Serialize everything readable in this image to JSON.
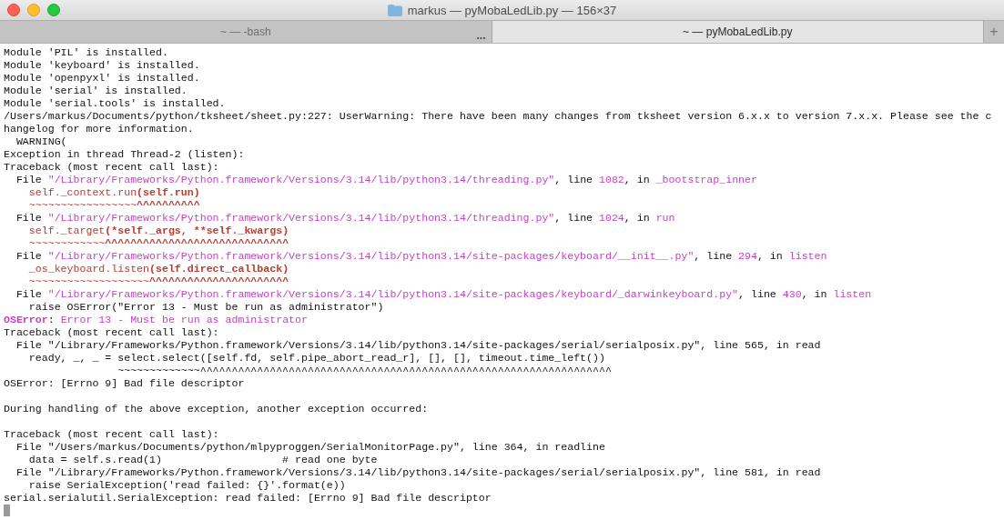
{
  "window": {
    "title": "markus — pyMobaLedLib.py — 156×37"
  },
  "tabs": [
    {
      "label": "~ — -bash",
      "selected": false,
      "more": "..."
    },
    {
      "label": "~ — pyMobaLedLib.py",
      "selected": true
    }
  ],
  "new_tab": "+",
  "terminal": {
    "cursor": true,
    "lines": [
      {
        "segs": [
          {
            "t": "Module 'PIL' is installed.",
            "kind": "plain"
          }
        ]
      },
      {
        "segs": [
          {
            "t": "Module 'keyboard' is installed.",
            "kind": "plain"
          }
        ]
      },
      {
        "segs": [
          {
            "t": "Module 'openpyxl' is installed.",
            "kind": "plain"
          }
        ]
      },
      {
        "segs": [
          {
            "t": "Module 'serial' is installed.",
            "kind": "plain"
          }
        ]
      },
      {
        "segs": [
          {
            "t": "Module 'serial.tools' is installed.",
            "kind": "plain"
          }
        ]
      },
      {
        "segs": [
          {
            "t": "/Users/markus/Documents/python/tksheet/sheet.py:227: UserWarning: There have been many changes from tksheet version 6.x.x to version 7.x.x. Please see the c",
            "kind": "plain"
          }
        ]
      },
      {
        "segs": [
          {
            "t": "hangelog for more information.",
            "kind": "plain"
          }
        ]
      },
      {
        "segs": [
          {
            "t": "  WARNING(",
            "kind": "plain"
          }
        ]
      },
      {
        "segs": [
          {
            "t": "Exception in thread Thread-2 (listen):",
            "kind": "plain"
          }
        ]
      },
      {
        "segs": [
          {
            "t": "Traceback (most recent call last):",
            "kind": "plain"
          }
        ]
      },
      {
        "segs": [
          {
            "t": "  File ",
            "kind": "plain"
          },
          {
            "t": "\"/Library/Frameworks/Python.framework/Versions/3.14/lib/python3.14/threading.py\"",
            "kind": "accent"
          },
          {
            "t": ", line ",
            "kind": "plain"
          },
          {
            "t": "1082",
            "kind": "accent"
          },
          {
            "t": ", in ",
            "kind": "plain"
          },
          {
            "t": "_bootstrap_inner",
            "kind": "accent"
          }
        ]
      },
      {
        "segs": [
          {
            "t": "    self._context.run",
            "kind": "code"
          },
          {
            "t": "(self.run)",
            "kind": "code_bold"
          }
        ]
      },
      {
        "segs": [
          {
            "t": "    ~~~~~~~~~~~~~~~~~",
            "kind": "code"
          },
          {
            "t": "^^^^^^^^^^",
            "kind": "code_bold"
          }
        ]
      },
      {
        "segs": [
          {
            "t": "  File ",
            "kind": "plain"
          },
          {
            "t": "\"/Library/Frameworks/Python.framework/Versions/3.14/lib/python3.14/threading.py\"",
            "kind": "accent"
          },
          {
            "t": ", line ",
            "kind": "plain"
          },
          {
            "t": "1024",
            "kind": "accent"
          },
          {
            "t": ", in ",
            "kind": "plain"
          },
          {
            "t": "run",
            "kind": "accent"
          }
        ]
      },
      {
        "segs": [
          {
            "t": "    self._target",
            "kind": "code"
          },
          {
            "t": "(*self._args, **self._kwargs)",
            "kind": "code_bold"
          }
        ]
      },
      {
        "segs": [
          {
            "t": "    ~~~~~~~~~~~~",
            "kind": "code"
          },
          {
            "t": "^^^^^^^^^^^^^^^^^^^^^^^^^^^^^",
            "kind": "code_bold"
          }
        ]
      },
      {
        "segs": [
          {
            "t": "  File ",
            "kind": "plain"
          },
          {
            "t": "\"/Library/Frameworks/Python.framework/Versions/3.14/lib/python3.14/site-packages/keyboard/__init__.py\"",
            "kind": "accent"
          },
          {
            "t": ", line ",
            "kind": "plain"
          },
          {
            "t": "294",
            "kind": "accent"
          },
          {
            "t": ", in ",
            "kind": "plain"
          },
          {
            "t": "listen",
            "kind": "accent"
          }
        ]
      },
      {
        "segs": [
          {
            "t": "    _os_keyboard.listen",
            "kind": "code"
          },
          {
            "t": "(self.direct_callback)",
            "kind": "code_bold"
          }
        ]
      },
      {
        "segs": [
          {
            "t": "    ~~~~~~~~~~~~~~~~~~~",
            "kind": "code"
          },
          {
            "t": "^^^^^^^^^^^^^^^^^^^^^^",
            "kind": "code_bold"
          }
        ]
      },
      {
        "segs": [
          {
            "t": "  File ",
            "kind": "plain"
          },
          {
            "t": "\"/Library/Frameworks/Python.framework/Versions/3.14/lib/python3.14/site-packages/keyboard/_darwinkeyboard.py\"",
            "kind": "accent"
          },
          {
            "t": ", line ",
            "kind": "plain"
          },
          {
            "t": "430",
            "kind": "accent"
          },
          {
            "t": ", in ",
            "kind": "plain"
          },
          {
            "t": "listen",
            "kind": "accent"
          }
        ]
      },
      {
        "segs": [
          {
            "t": "    raise OSError(\"Error 13 - Must be run as administrator\")",
            "kind": "plain"
          }
        ]
      },
      {
        "segs": [
          {
            "t": "OSError",
            "kind": "accent_bold"
          },
          {
            "t": ": ",
            "kind": "plain"
          },
          {
            "t": "Error 13 - Must be run as administrator",
            "kind": "accent"
          }
        ]
      },
      {
        "segs": [
          {
            "t": "Traceback (most recent call last):",
            "kind": "plain"
          }
        ]
      },
      {
        "segs": [
          {
            "t": "  File \"/Library/Frameworks/Python.framework/Versions/3.14/lib/python3.14/site-packages/serial/serialposix.py\", line 565, in read",
            "kind": "plain"
          }
        ]
      },
      {
        "segs": [
          {
            "t": "    ready, _, _ = select.select([self.fd, self.pipe_abort_read_r], [], [], timeout.time_left())",
            "kind": "plain"
          }
        ]
      },
      {
        "segs": [
          {
            "t": "                  ~~~~~~~~~~~~~^^^^^^^^^^^^^^^^^^^^^^^^^^^^^^^^^^^^^^^^^^^^^^^^^^^^^^^^^^^^^^^^^",
            "kind": "plain"
          }
        ]
      },
      {
        "segs": [
          {
            "t": "OSError: [Errno 9] Bad file descriptor",
            "kind": "plain"
          }
        ]
      },
      {
        "blank_before": true,
        "segs": [
          {
            "t": "During handling of the above exception, another exception occurred:",
            "kind": "plain"
          }
        ]
      },
      {
        "blank_before": true,
        "segs": [
          {
            "t": "Traceback (most recent call last):",
            "kind": "plain"
          }
        ]
      },
      {
        "segs": [
          {
            "t": "  File \"/Users/markus/Documents/python/mlpyproggen/SerialMonitorPage.py\", line 364, in readline",
            "kind": "plain"
          }
        ]
      },
      {
        "segs": [
          {
            "t": "    data = self.s.read(1)                   # read one byte",
            "kind": "plain"
          }
        ]
      },
      {
        "segs": [
          {
            "t": "  File \"/Library/Frameworks/Python.framework/Versions/3.14/lib/python3.14/site-packages/serial/serialposix.py\", line 581, in read",
            "kind": "plain"
          }
        ]
      },
      {
        "segs": [
          {
            "t": "    raise SerialException('read failed: {}'.format(e))",
            "kind": "plain"
          }
        ]
      },
      {
        "segs": [
          {
            "t": "serial.serialutil.SerialException: read failed: [Errno 9] Bad file descriptor",
            "kind": "plain"
          }
        ]
      }
    ]
  }
}
